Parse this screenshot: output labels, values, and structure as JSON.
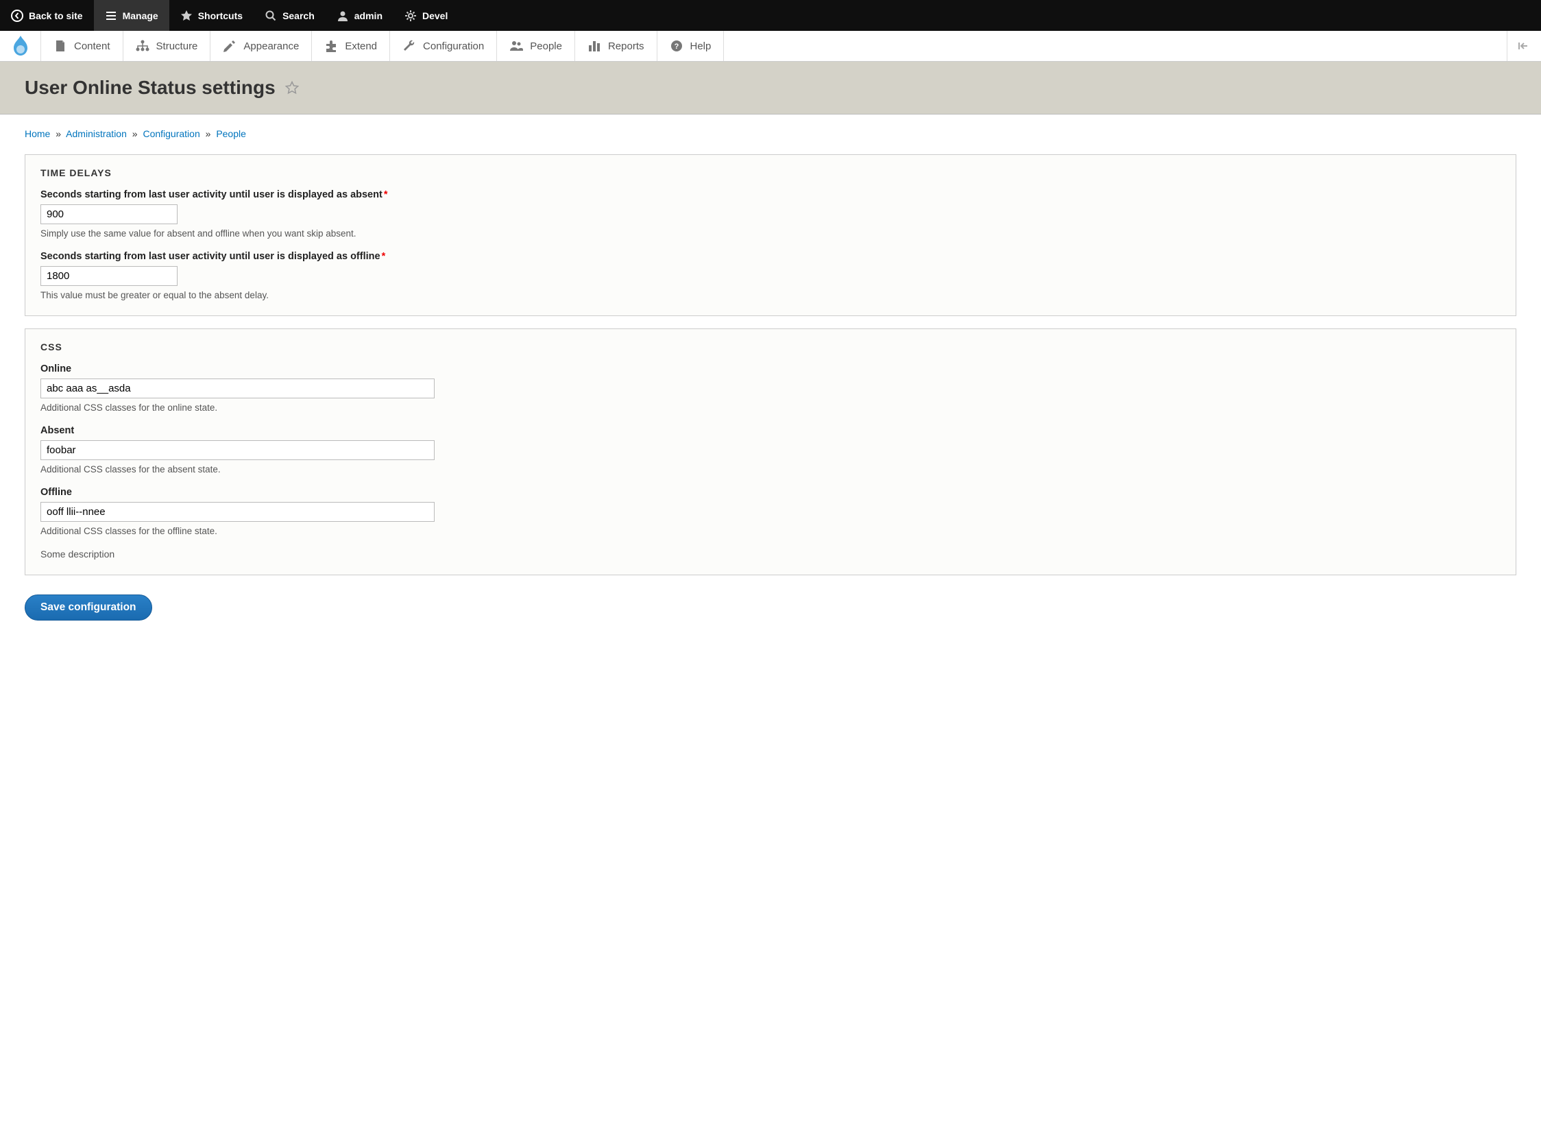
{
  "toolbar": {
    "back": "Back to site",
    "manage": "Manage",
    "shortcuts": "Shortcuts",
    "search": "Search",
    "admin": "admin",
    "devel": "Devel"
  },
  "adminMenu": {
    "content": "Content",
    "structure": "Structure",
    "appearance": "Appearance",
    "extend": "Extend",
    "configuration": "Configuration",
    "people": "People",
    "reports": "Reports",
    "help": "Help"
  },
  "page": {
    "title": "User Online Status settings"
  },
  "breadcrumb": {
    "home": "Home",
    "administration": "Administration",
    "configuration": "Configuration",
    "people": "People"
  },
  "fieldsets": {
    "timeDelays": {
      "legend": "TIME DELAYS",
      "absent": {
        "label": "Seconds starting from last user activity until user is displayed as absent",
        "value": "900",
        "desc": "Simply use the same value for absent and offline when you want skip absent."
      },
      "offline": {
        "label": "Seconds starting from last user activity until user is displayed as offline",
        "value": "1800",
        "desc": "This value must be greater or equal to the absent delay."
      }
    },
    "css": {
      "legend": "CSS",
      "online": {
        "label": "Online",
        "value": "abc aaa as__asda",
        "desc": "Additional CSS classes for the online state."
      },
      "absent": {
        "label": "Absent",
        "value": "foobar",
        "desc": "Additional CSS classes for the absent state."
      },
      "offline": {
        "label": "Offline",
        "value": "ooff llii--nnee",
        "desc": "Additional CSS classes for the offline state."
      },
      "extra": "Some description"
    }
  },
  "actions": {
    "save": "Save configuration"
  }
}
